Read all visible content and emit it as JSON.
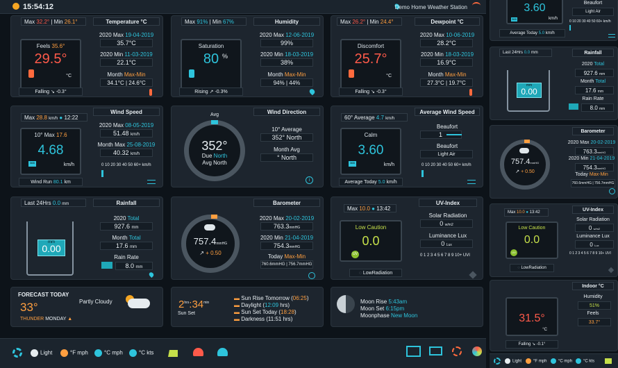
{
  "topbar": {
    "time": "15:54:12",
    "station": "Demo Home Weather Station"
  },
  "temp": {
    "max": "32.2°",
    "min": "26.1°",
    "title": "Temperature °C",
    "feels_label": "Feels",
    "feels": "35.6°",
    "value": "29.5°",
    "unit": "°C",
    "trend": "Falling ↘ -0.3°",
    "ymax_l": "2020 Max",
    "ymax_d": "19-04-2019",
    "ymax": "35.7°C",
    "ymin_l": "2020 Min",
    "ymin_d": "11-03-2019",
    "ymin": "22.1°C",
    "month_l": "Month",
    "month_k": "Max-Min",
    "month": "34.1°C | 24.6°C"
  },
  "hum": {
    "max": "91%",
    "min": "67%",
    "title": "Humidity",
    "cap": "Saturation",
    "value": "80",
    "unit": "%",
    "trend": "Rising ↗ -0.3%",
    "ymax_d": "12-06-2019",
    "ymax": "99%",
    "ymin_d": "18-03-2019",
    "ymin": "38%",
    "month": "94% | 44%",
    "ymax_l": "2020 Max",
    "ymin_l": "2020 Min",
    "month_l": "Month",
    "month_k": "Max-Min"
  },
  "dew": {
    "max": "26.2°",
    "min": "24.4°",
    "title": "Dewpoint °C",
    "cap": "Discomfort",
    "value": "25.7°",
    "unit": "°C",
    "trend": "Falling ↘ -0.3°",
    "ymax_d": "10-06-2019",
    "ymax": "28.2°C",
    "ymin_d": "18-03-2019",
    "ymin": "16.9°C",
    "month": "27.3°C | 19.7°C",
    "ymax_l": "2020 Max",
    "ymin_l": "2020 Min",
    "month_l": "Month",
    "month_k": "Max-Min"
  },
  "wind": {
    "max": "28.8",
    "unit_kmh": "km/h",
    "time": "12:22",
    "title": "Wind Speed",
    "cap": "10° Max",
    "capv": "17.6",
    "value": "4.68",
    "unit": "km/h",
    "run_l": "Wind Run",
    "run": "80.1",
    "run_u": "km",
    "ymax_l": "2020 Max",
    "ymax_d": "08-05-2019",
    "ymax": "51.48",
    "ymonth_l": "Month Max",
    "ymonth_d": "25-08-2019",
    "ymonth": "40.32",
    "scale": "0 10 20 30 40 50 60+ km/h",
    "sbox": "365"
  },
  "wdir": {
    "title": "Wind Direction",
    "avg": "Avg",
    "deg": "352°",
    "due_l": "Due",
    "due": "North",
    "avgdir": "Avg North",
    "ten_l": "10° Average",
    "ten": "352° North",
    "month_l": "Month Avg",
    "month": "° North"
  },
  "awind": {
    "avg_l": "60° Average",
    "avg": "4.7",
    "unit": "km/h",
    "title": "Average Wind Speed",
    "cap": "Calm",
    "value": "3.60",
    "v_unit": "km/h",
    "today_l": "Average Today",
    "today": "5.0",
    "today_u": "km/h",
    "beau_l": "Beaufort",
    "beau": "1",
    "beau2_l": "Beaufort",
    "beau2": "Light Air",
    "scale": "0 10 20 30 40 50 60+ km/h",
    "sbox": "365"
  },
  "rain": {
    "last_l": "Last 24Hrs",
    "last": "0.0",
    "last_u": "mm",
    "title": "Rainfall",
    "unit": "mm",
    "value": "0.00",
    "total_l": "2020",
    "total_k": "Total",
    "total": "927.6",
    "total_u": "mm",
    "month_l": "Month",
    "month_k": "Total",
    "month": "17.6",
    "month_u": "mm",
    "rate_l": "Rain Rate",
    "rate": "8.0",
    "rate_u": "mm"
  },
  "baro": {
    "title": "Barometer",
    "value": "757.4",
    "unit": "mmHG",
    "trend": "+ 0.50",
    "ymax_l": "2020 Max",
    "ymax_d": "20-02-2019",
    "ymax": "763.3",
    "ymin_l": "2020 Min",
    "ymin_d": "21-04-2019",
    "ymin": "754.3",
    "today_l": "Today",
    "today_k": "Max-Min",
    "today": "760.6mmHG | 756.7mmHG",
    "u": "mmHG"
  },
  "uv": {
    "max": "10.0",
    "time": "13:42",
    "title": "UV-Index",
    "cap": "Low Caution",
    "value": "0.0",
    "badge": "UV",
    "low": "LowRadiation",
    "solar_l": "Solar Radiation",
    "solar": "0",
    "solar_u": "w/m2",
    "lum_l": "Luminance Lux",
    "lum": "0",
    "lum_u": "Lux",
    "scale": "0 1 2 3 4 5 6 7 8 9 10+ UVI"
  },
  "forecast": {
    "title": "FORECAST TODAY",
    "temp": "33°",
    "desc": "Partly Cloudy",
    "thunder": "THUNDER",
    "day": "MONDAY"
  },
  "sun": {
    "hrs": "2",
    "hrs_u": "hrs",
    "min": "34",
    "min_u": "min",
    "set": "Sun Set",
    "rise_t": "Sun Rise Tomorrow",
    "rise": "06:25",
    "daylight_l": "Daylight",
    "daylight": "12:09",
    "daylight_u": "hrs",
    "settoday_l": "Sun Set Today",
    "settoday": "18:28",
    "dark_l": "Darkness",
    "dark": "11:51 hrs"
  },
  "moon": {
    "rise_l": "Moon Rise",
    "rise": "5:43am",
    "set_l": "Moon Set",
    "set": "6:15pm",
    "phase_l": "Moonphase",
    "phase": "New Moon"
  },
  "bottom": {
    "light": "Light",
    "f": "°F mph",
    "c": "°C mph",
    "ckts": "°C kts"
  },
  "right": {
    "aw": {
      "value": "3.60",
      "unit": "km/h",
      "today_l": "Average Today",
      "today": "5.0",
      "today_u": "km/h",
      "beau_l": "Beaufort",
      "beau": "Light Air",
      "scale": "0 10 20 30 40 50 60+ km/h",
      "sbox": "365"
    },
    "rain": {
      "last_l": "Last 24Hrs",
      "last": "0.0",
      "last_u": "mm",
      "title": "Rainfall",
      "value": "0.00",
      "unit": "mm",
      "total_l": "2020",
      "total_k": "Total",
      "total": "927.6",
      "total_u": "mm",
      "month_l": "Month",
      "month_k": "Total",
      "month": "17.6",
      "month_u": "mm",
      "rate_l": "Rain Rate",
      "rate": "8.0",
      "rate_u": "mm"
    },
    "baro": {
      "title": "Barometer",
      "value": "757.4",
      "unit": "mmHG",
      "trend": "+ 0.50",
      "ymax_l": "2020 Max",
      "ymax_d": "20-02-2019",
      "ymax": "763.3",
      "ymin_l": "2020 Min",
      "ymin_d": "21-04-2019",
      "ymin": "754.3",
      "today_l": "Today",
      "today_k": "Max-Min",
      "today": "760.6mmHG | 756.7mmHG",
      "u": "mmHG"
    },
    "uv": {
      "max": "10.0",
      "time": "13:42",
      "title": "UV-Index",
      "cap": "Low Caution",
      "value": "0.0",
      "badge": "UV",
      "low": "LowRadiation",
      "solar_l": "Solar Radiation",
      "solar": "0",
      "solar_u": "w/m2",
      "lum_l": "Luminance Lux",
      "lum": "0",
      "lum_u": "Lux",
      "scale": "0 1 2 3 4 5 6 7 8 9 10+ UVI"
    },
    "indoor": {
      "title": "Indoor °C",
      "hum_l": "Humidity",
      "hum": "51%",
      "feels_l": "Feels",
      "feels": "33.7°",
      "value": "31.5°",
      "unit": "°C",
      "trend": "Falling ↘ -0.1°"
    },
    "bottom": {
      "light": "Light",
      "f": "°F mph",
      "c": "°C mph",
      "ckts": "°C kts"
    }
  },
  "colors": {
    "accent": "#2ec4dc",
    "orange": "#ff9f40",
    "red": "#ff5a4a",
    "panel": "#1d252e",
    "bg": "#0d1319"
  }
}
